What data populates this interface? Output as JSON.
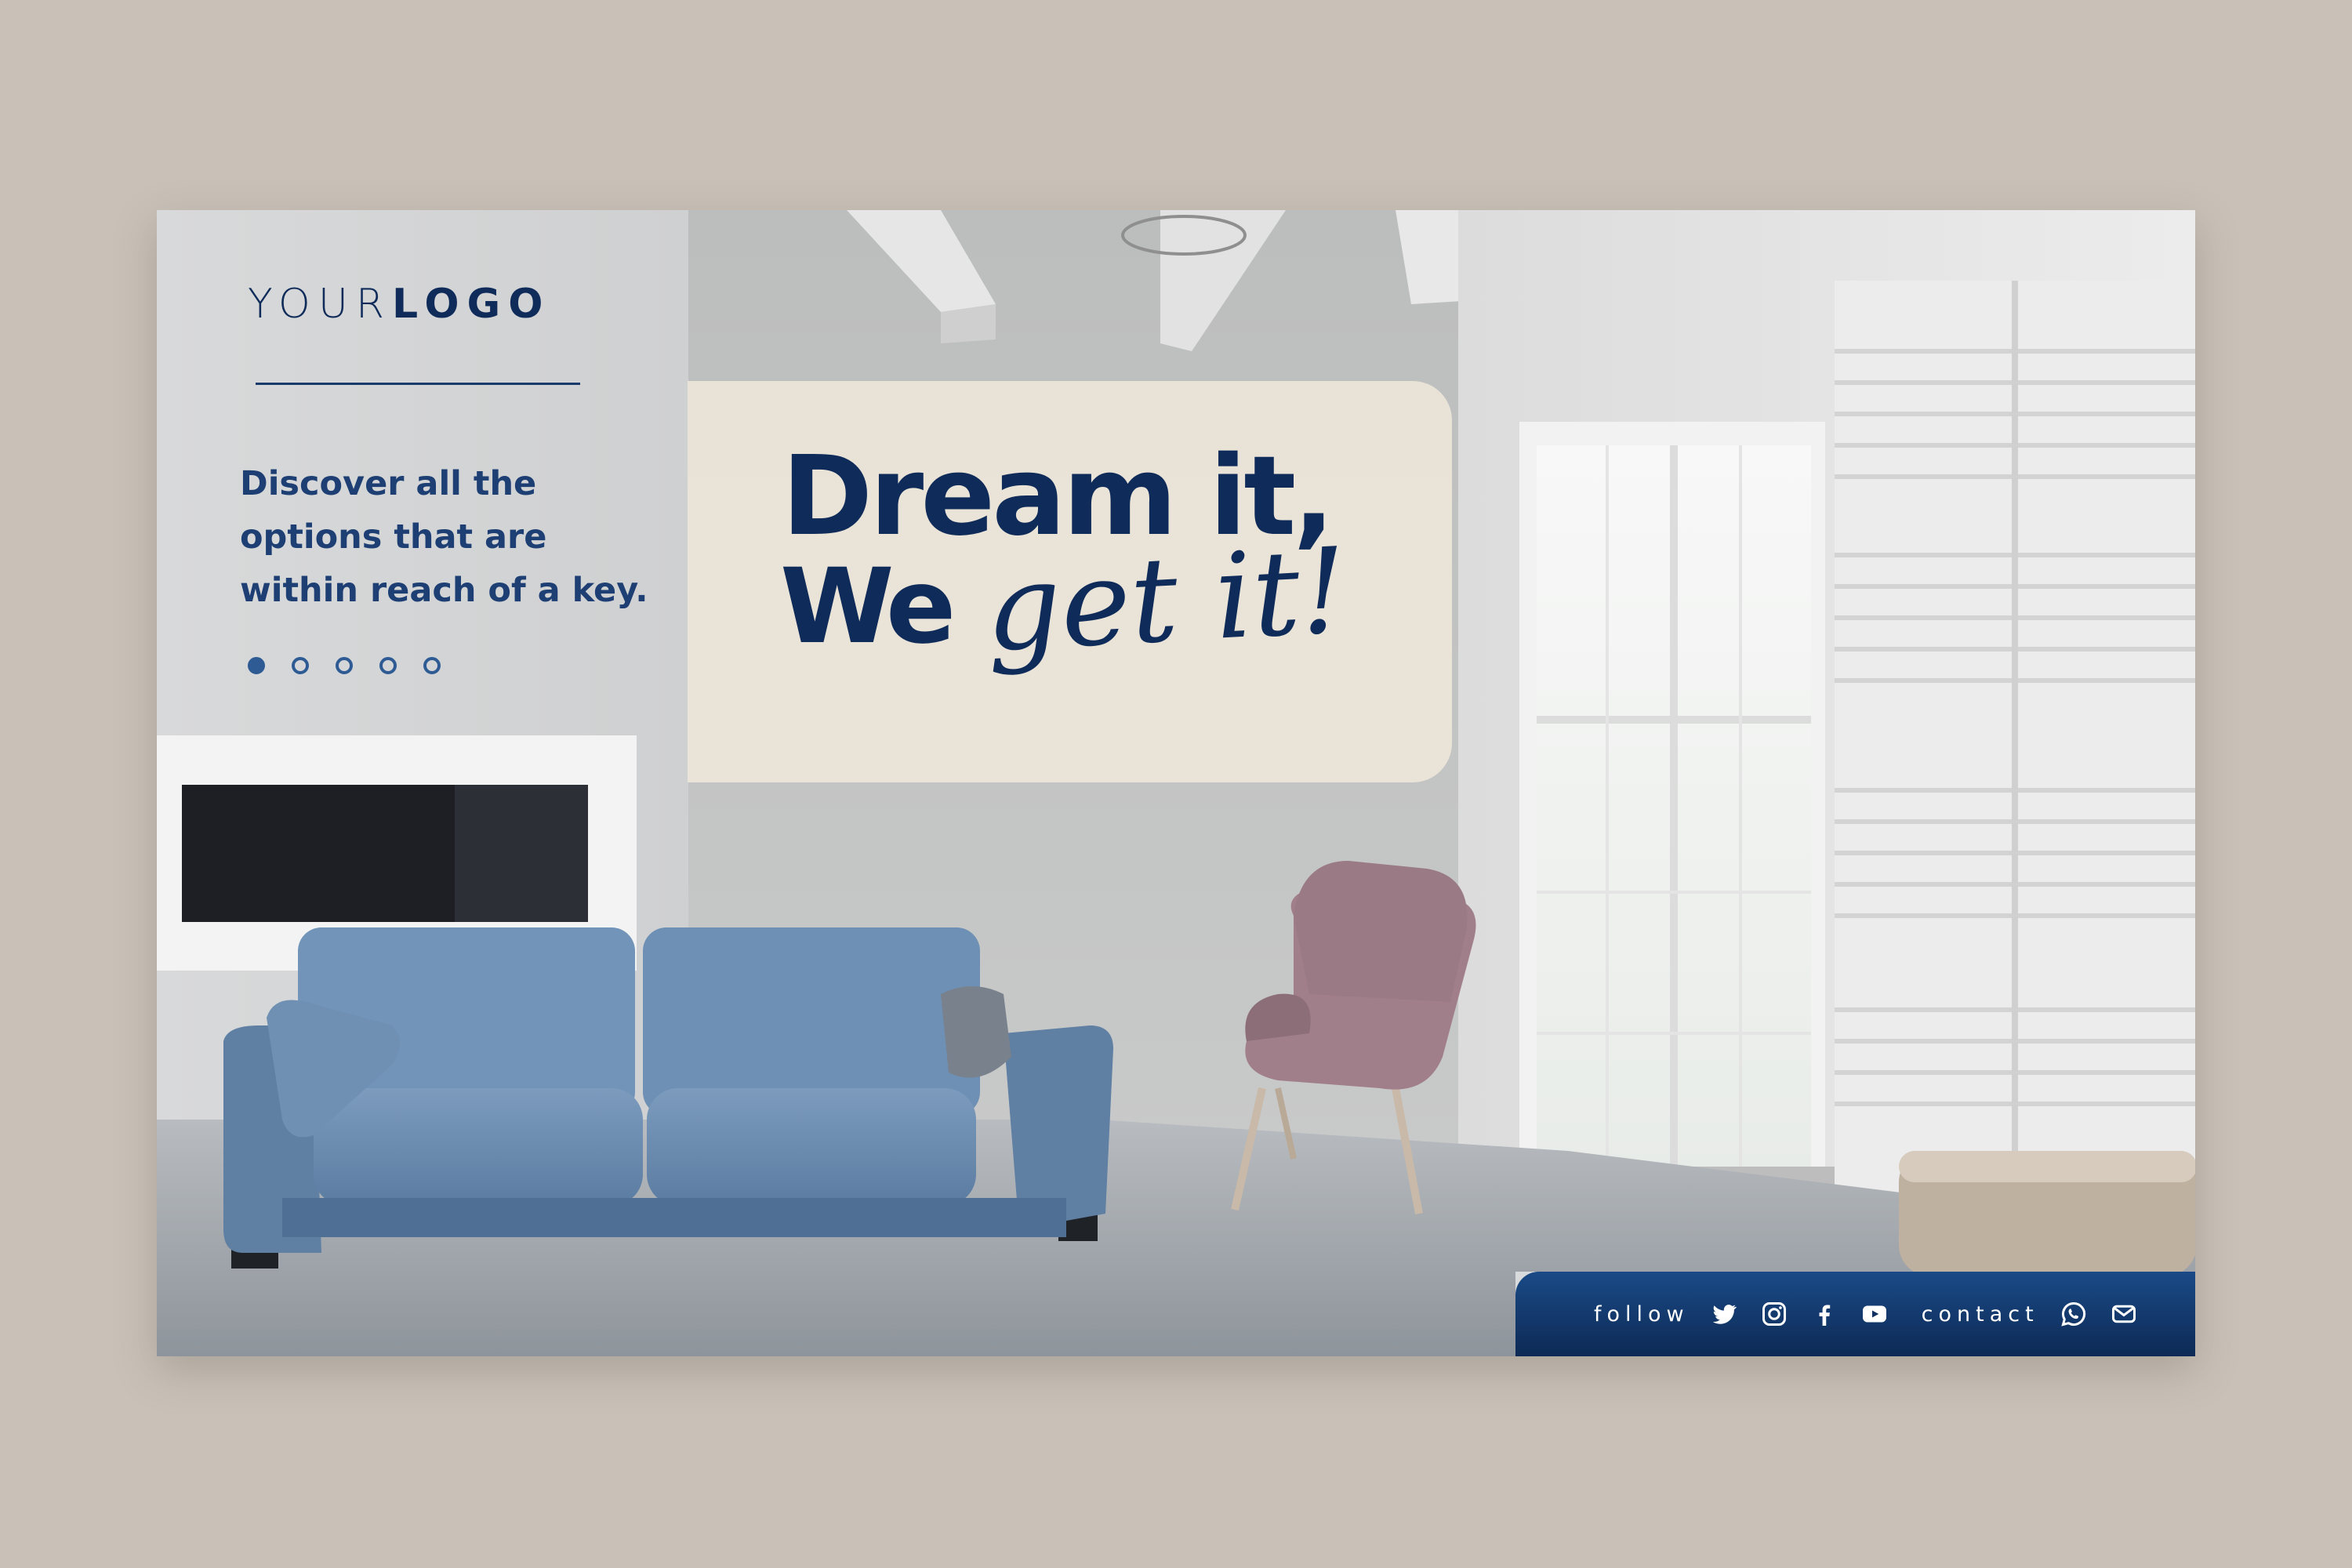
{
  "logo": {
    "part1": "YOUR",
    "part2": "LOGO"
  },
  "tagline": "Discover all the options that are within reach of a key.",
  "carousel": {
    "total": 5,
    "active_index": 0
  },
  "headline": {
    "line1": "Dream it,",
    "line2a": "We",
    "line2b": "get it!"
  },
  "footer": {
    "follow_label": "follow",
    "contact_label": "contact"
  },
  "icons": [
    "twitter-icon",
    "instagram-icon",
    "facebook-icon",
    "youtube-icon",
    "whatsapp-icon",
    "mail-icon"
  ],
  "colors": {
    "navy": "#0f2b5a",
    "accent_blue": "#2e5b94",
    "card": "#ece4d8",
    "background": "#c9c1b8"
  }
}
